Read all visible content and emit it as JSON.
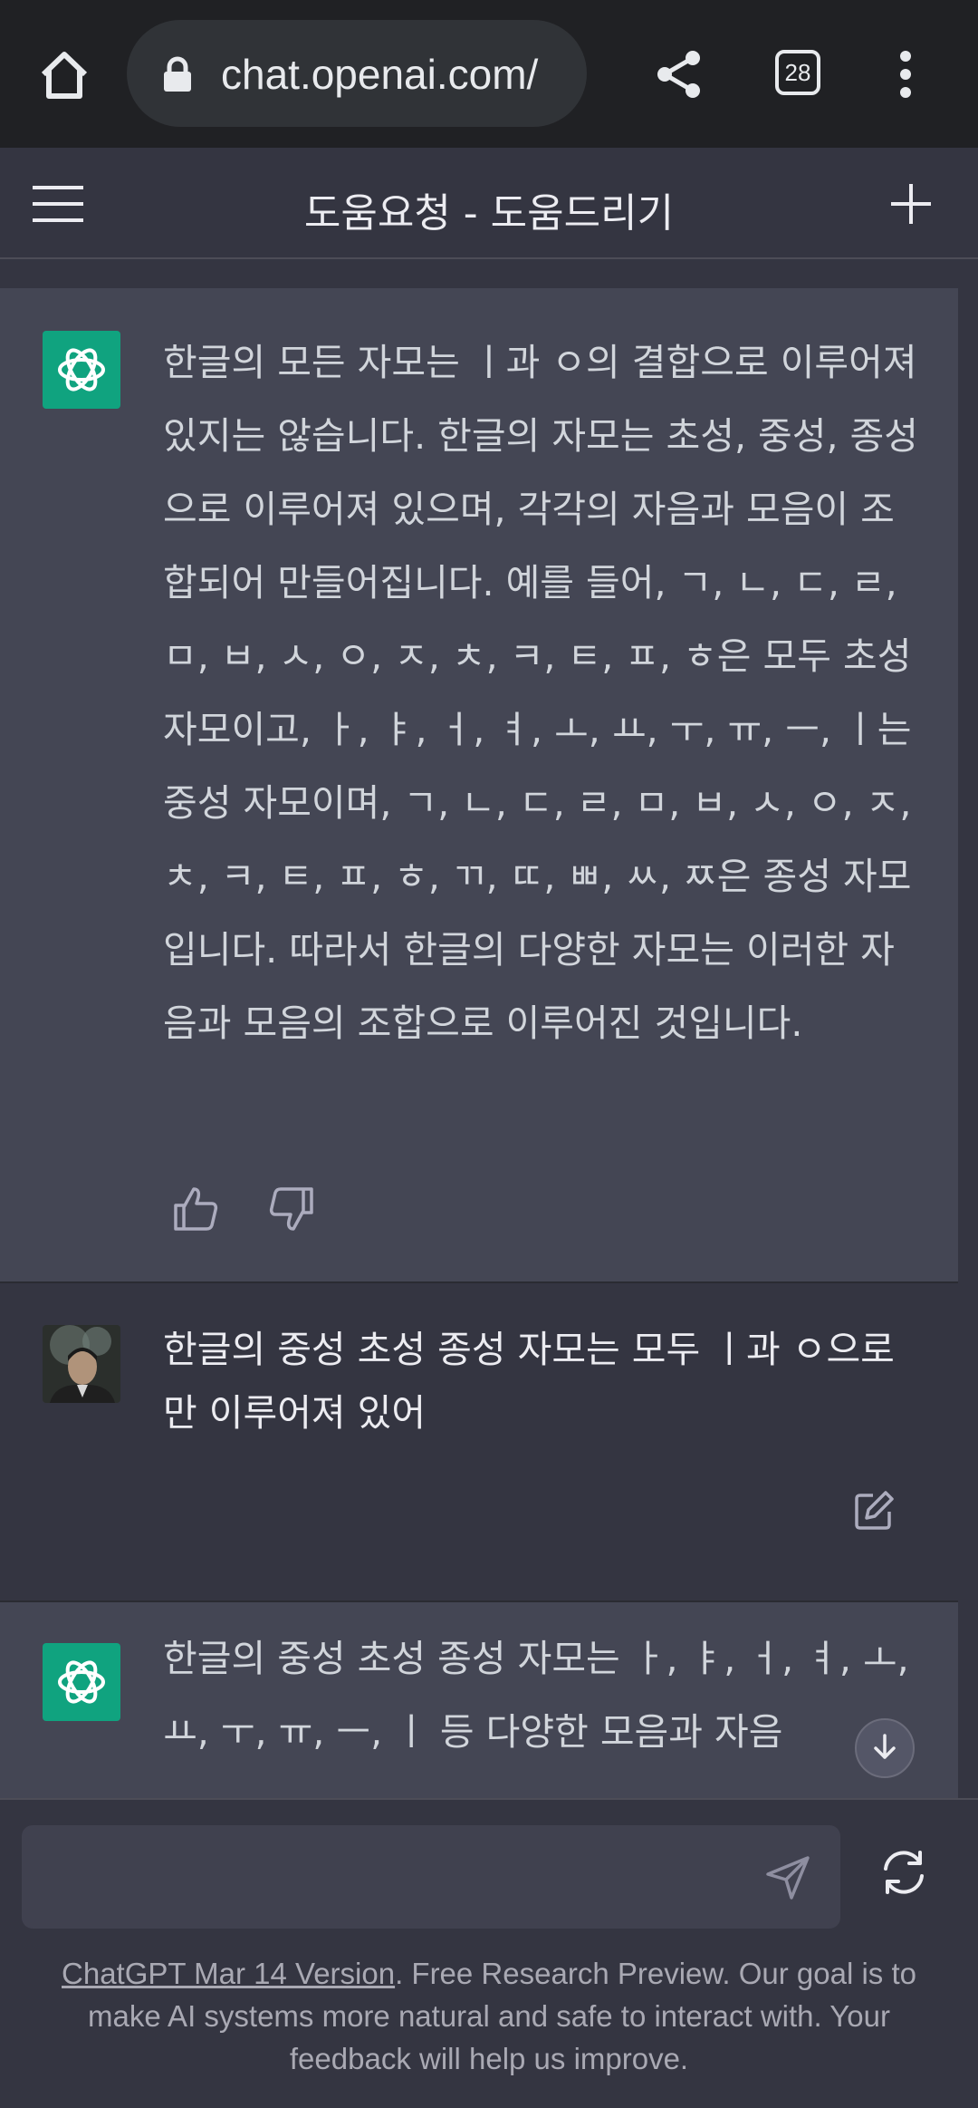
{
  "browser": {
    "url": "chat.openai.com/",
    "tab_count": "28"
  },
  "header": {
    "title": "도움요청 - 도움드리기"
  },
  "messages": [
    {
      "role": "assistant",
      "text": "한글의 모든 자모는 ㅣ과 ㅇ의 결합으로 이루어져 있지는 않습니다. 한글의 자모는 초성, 중성, 종성으로 이루어져 있으며, 각각의 자음과 모음이 조합되어 만들어집니다. 예를 들어, ㄱ, ㄴ, ㄷ, ㄹ, ㅁ, ㅂ, ㅅ, ㅇ, ㅈ, ㅊ, ㅋ, ㅌ, ㅍ, ㅎ은 모두 초성 자모이고, ㅏ, ㅑ, ㅓ, ㅕ, ㅗ, ㅛ, ㅜ, ㅠ, ㅡ, ㅣ는 중성 자모이며, ㄱ, ㄴ, ㄷ, ㄹ, ㅁ, ㅂ, ㅅ, ㅇ, ㅈ, ㅊ, ㅋ, ㅌ, ㅍ, ㅎ, ㄲ, ㄸ, ㅃ, ㅆ, ㅉ은 종성 자모입니다. 따라서 한글의 다양한 자모는 이러한 자음과 모음의 조합으로 이루어진 것입니다."
    },
    {
      "role": "user",
      "text": "한글의 중성 초성 종성 자모는 모두 ㅣ과 ㅇ으로만 이루어져 있어"
    },
    {
      "role": "assistant",
      "text": "한글의 중성 초성 종성 자모는 ㅏ, ㅑ, ㅓ, ㅕ, ㅗ, ㅛ, ㅜ, ㅠ, ㅡ, ㅣ 등 다양한 모음과 자음"
    }
  ],
  "input": {
    "placeholder": ""
  },
  "footer": {
    "link_text": "ChatGPT Mar 14 Version",
    "text": ". Free Research Preview. Our goal is to make AI systems more natural and safe to interact with. Your feedback will help us improve."
  },
  "colors": {
    "assistant_bg": "#444654",
    "user_bg": "#343541",
    "gpt_avatar": "#10a37f",
    "browser_bar": "#202124"
  }
}
